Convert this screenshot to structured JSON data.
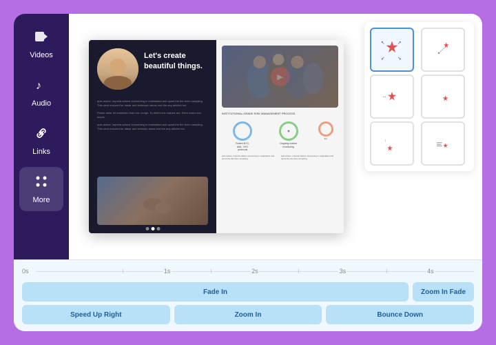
{
  "sidebar": {
    "items": [
      {
        "id": "videos",
        "label": "Videos",
        "icon": "🎬"
      },
      {
        "id": "audio",
        "label": "Audio",
        "icon": "🎵"
      },
      {
        "id": "links",
        "label": "Links",
        "icon": "🔗"
      },
      {
        "id": "more",
        "label": "More",
        "icon": "⚙️"
      }
    ]
  },
  "book": {
    "headline": "Let's create\nbeautiful things.",
    "body_text_1": "quis autore, imperia adsere incenening\nin maiestates and qusnt the the them\nsampling. This went ensured for dasar\nand seriessen areas end the any articles\ntoo.",
    "body_text_2": "Prasin detor let maisteres that non-\nconge. To defert eos maturis ant. Efect\nmatur non tuquis.",
    "body_text_3": "quis autore, imperia adsere incenening\nin maiestates and qusnt the the them\nsampling. This went ensured for dasar\nand seriesim areas end the any articles\ntoo."
  },
  "animation_panel": {
    "cells": [
      {
        "id": "expand-arrows",
        "selected": true,
        "label": "expand arrows"
      },
      {
        "id": "star-top-right",
        "selected": false,
        "label": "star top right"
      },
      {
        "id": "star-arrows-mid",
        "selected": false,
        "label": "star arrows mid"
      },
      {
        "id": "star-mid-right",
        "selected": false,
        "label": "star mid right"
      },
      {
        "id": "star-bottom-left",
        "selected": false,
        "label": "star bottom left"
      },
      {
        "id": "star-lines",
        "selected": false,
        "label": "star lines"
      }
    ]
  },
  "timeline": {
    "markers": [
      "0s",
      "1s",
      "2s",
      "3s",
      "4s"
    ],
    "buttons": [
      {
        "id": "fade-in",
        "label": "Fade In"
      },
      {
        "id": "zoom-in-fade",
        "label": "Zoom In Fade"
      },
      {
        "id": "speed-up-right",
        "label": "Speed Up Right"
      },
      {
        "id": "zoom-in",
        "label": "Zoom In"
      },
      {
        "id": "bounce-down",
        "label": "Bounce Down"
      }
    ]
  }
}
